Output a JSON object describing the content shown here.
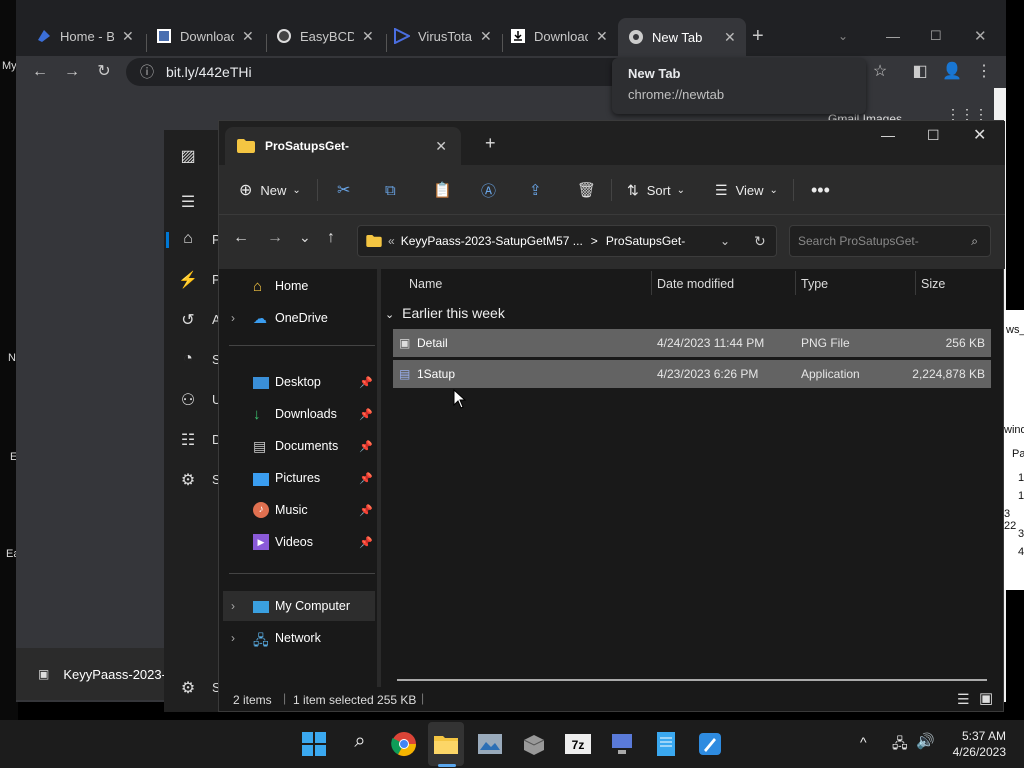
{
  "desktop": {
    "left_labels": [
      "My",
      "N",
      "E",
      "Ea"
    ],
    "right_labels": [
      "ws_",
      "wind",
      "Pa",
      "1",
      "1",
      "3 22",
      "3",
      "4"
    ]
  },
  "chrome": {
    "tabs": [
      {
        "label": "Home - Bo",
        "icon": "blue-app-icon"
      },
      {
        "label": "Downloads",
        "icon": "download-page-icon"
      },
      {
        "label": "EasyBCD 2",
        "icon": "wordpress-icon"
      },
      {
        "label": "VirusTotal",
        "icon": "virustotal-icon"
      },
      {
        "label": "Download",
        "icon": "download-icon"
      },
      {
        "label": "New Tab",
        "icon": "chrome-icon"
      }
    ],
    "new_tab_symbol": "+",
    "url": "bit.ly/442eTHi",
    "tooltip": {
      "title": "New Tab",
      "url": "chrome://newtab"
    },
    "behind_text": "Gmail   Images"
  },
  "settings": {
    "items": [
      "P",
      "P",
      "A",
      "S",
      "U",
      "D",
      "S"
    ],
    "bottom_item": "S"
  },
  "explorer": {
    "tab_title": "ProSatupsGet-",
    "toolbar": {
      "new_label": "New",
      "sort_label": "Sort",
      "view_label": "View"
    },
    "address": {
      "prefix": "«",
      "parent": "KeyyPaass-2023-SatupGetM57 ...",
      "separator": ">",
      "current": "ProSatupsGet-"
    },
    "search_placeholder": "Search ProSatupsGet-",
    "nav": {
      "home": "Home",
      "onedrive": "OneDrive",
      "quick": [
        "Desktop",
        "Downloads",
        "Documents",
        "Pictures",
        "Music",
        "Videos"
      ],
      "my_computer": "My Computer",
      "network": "Network"
    },
    "columns": [
      "Name",
      "Date modified",
      "Type",
      "Size"
    ],
    "group": "Earlier this week",
    "files": [
      {
        "name": "Detail",
        "date": "4/24/2023 11:44 PM",
        "type": "PNG File",
        "size": "256 KB"
      },
      {
        "name": "1Satup",
        "date": "4/23/2023 6:26 PM",
        "type": "Application",
        "size": "2,224,878 KB"
      }
    ],
    "status": {
      "items": "2 items",
      "selected": "1 item selected  255 KB"
    }
  },
  "bottom_window": {
    "title": "KeyyPaass-2023-"
  },
  "taskbar": {
    "time": "5:37 AM",
    "date": "4/26/2023"
  },
  "colors": {
    "accent": "#0078d4",
    "selection": "#636363",
    "folder": "#f4c542"
  }
}
